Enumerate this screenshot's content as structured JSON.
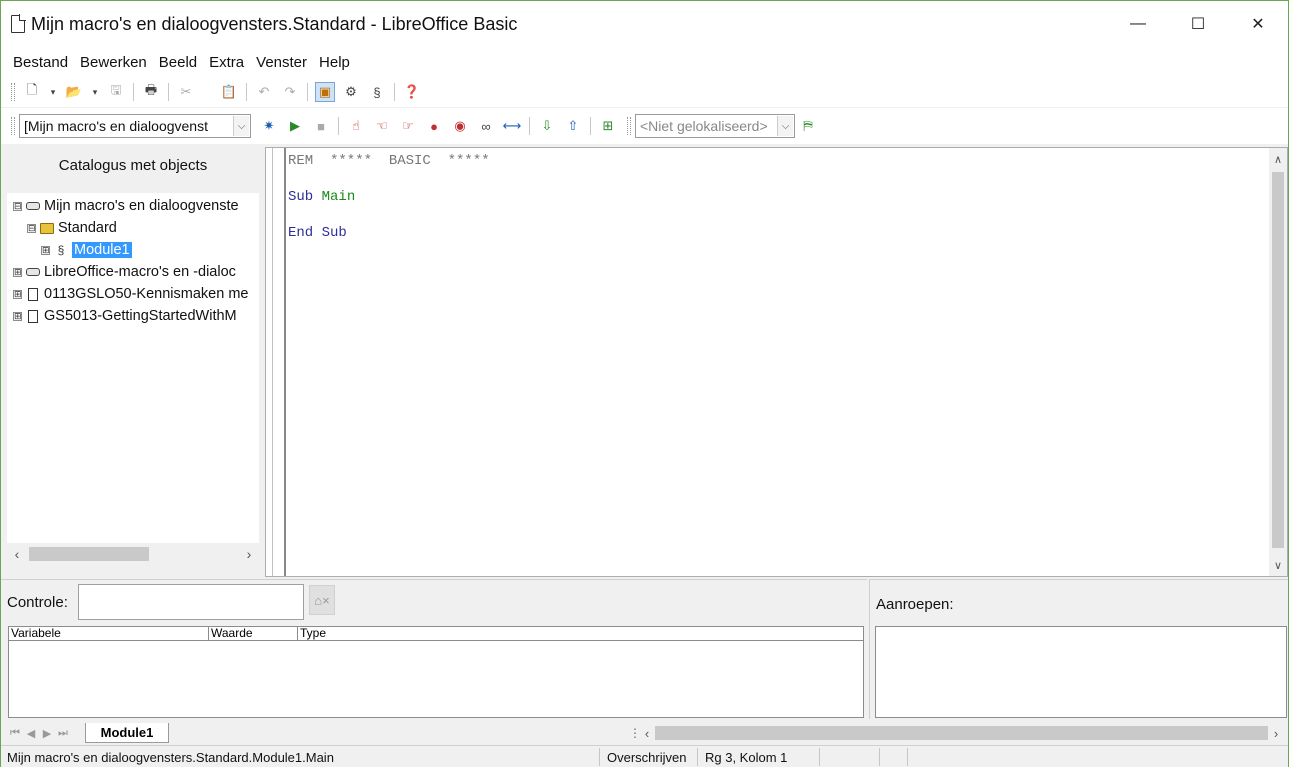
{
  "window": {
    "title": "Mijn macro's en dialoogvensters.Standard - LibreOffice Basic",
    "minimize": "—",
    "maximize": "☐",
    "close": "✕"
  },
  "menu": [
    "Bestand",
    "Bewerken",
    "Beeld",
    "Extra",
    "Venster",
    "Help"
  ],
  "toolbar": {
    "library_combo": "[Mijn macro's en dialoogvenst",
    "language_combo": "<Niet gelokaliseerd>"
  },
  "catalog": {
    "title": "Catalogus met objects",
    "items": [
      {
        "label": "Mijn macro's en dialoogvenste",
        "expander": "⊟"
      },
      {
        "label": "Standard",
        "expander": "⊟"
      },
      {
        "label": "Module1",
        "expander": "⊞"
      },
      {
        "label": "LibreOffice-macro's en -dialoc",
        "expander": "⊞"
      },
      {
        "label": "0113GSLO50-Kennismaken me",
        "expander": "⊞"
      },
      {
        "label": "GS5013-GettingStartedWithM",
        "expander": "⊞"
      }
    ]
  },
  "editor": {
    "line1": "REM  *****  BASIC  *****",
    "line3_kw": "Sub",
    "line3_id": "Main",
    "line5": "End Sub"
  },
  "watch": {
    "label": "Controle:",
    "columns": [
      "Variabele",
      "Waarde",
      "Type"
    ]
  },
  "callstack": {
    "label": "Aanroepen:"
  },
  "tabs": {
    "active": "Module1"
  },
  "status": {
    "path": "Mijn macro's en dialoogvensters.Standard.Module1.Main",
    "mode": "Overschrijven",
    "position": "Rg 3, Kolom 1"
  }
}
